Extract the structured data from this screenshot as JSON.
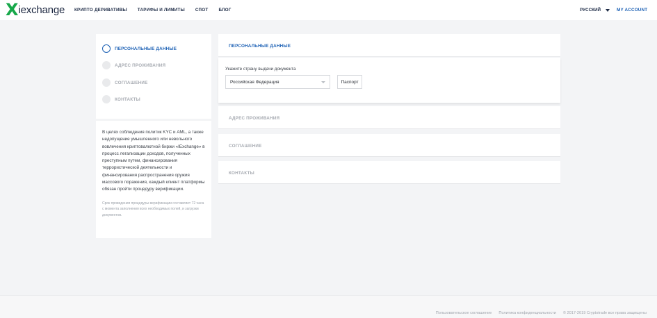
{
  "header": {
    "logo_mark": "X",
    "logo_text": "iexchange",
    "nav": [
      "КРИПТО ДЕРИВАТИВЫ",
      "ТАРИФЫ И ЛИМИТЫ",
      "СПОТ",
      "БЛОГ"
    ],
    "language": "РУССКИЙ",
    "account": "MY ACCOUNT"
  },
  "steps": [
    {
      "label": "ПЕРСОНАЛЬНЫЕ ДАННЫЕ",
      "active": true
    },
    {
      "label": "АДРЕС ПРОЖИВАНИЯ",
      "active": false
    },
    {
      "label": "СОГЛАШЕНИЕ",
      "active": false
    },
    {
      "label": "КОНТАКТЫ",
      "active": false
    }
  ],
  "info": {
    "text": "В целях соблюдения политик KYC и AML, а также недопущение умышленного или невольного вовлечения криптовалютной биржи «IExchange» в процесс легализации доходов, полученных преступным путем, финансирования террористической деятельности и финансирования распространения оружия массового поражения, каждый клиент платформы обязан пройти процедуру верификации.",
    "note": "Срок проведения процедуры верификации составляет 72 часа с момента заполнения всех необходимых полей, и загрузки документов."
  },
  "personal": {
    "title": "ПЕРСОНАЛЬНЫЕ ДАННЫЕ",
    "country_label": "Укажите страну выдачи документа",
    "country_value": "Российская Федерация",
    "document_button": "Паспорт"
  },
  "sections": [
    "АДРЕС ПРОЖИВАНИЯ",
    "СОГЛАШЕНИЕ",
    "КОНТАКТЫ"
  ],
  "footer": {
    "links": [
      "Пользовательское соглашение",
      "Политика конфиденциальности"
    ],
    "copyright": "© 2017-2019 Cryptotrade все права защищены"
  },
  "colors": {
    "accent": "#1a5fb4",
    "brand_green": "#17a84a"
  }
}
